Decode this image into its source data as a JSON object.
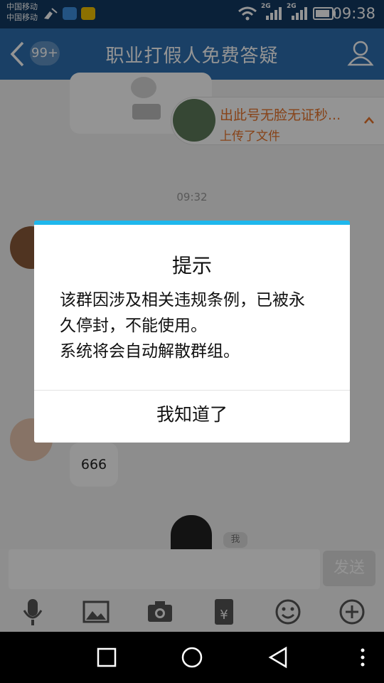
{
  "status_bar": {
    "carrier1": "中国移动",
    "carrier2": "中国移动",
    "network1": "2G",
    "network2": "2G",
    "time": "09:38"
  },
  "header": {
    "back_badge": "99+",
    "title": "职业打假人免费答疑"
  },
  "notification": {
    "title": "出此号无脸无证秒...",
    "subtitle": "上传了文件"
  },
  "chat": {
    "timestamp": "09:32",
    "message_666": "666",
    "self_tag": "我"
  },
  "input_bar": {
    "placeholder": "",
    "send_label": "发送",
    "tools": [
      "mic-icon",
      "image-icon",
      "camera-icon",
      "red-packet-icon",
      "emoji-icon",
      "plus-icon"
    ]
  },
  "dialog": {
    "title": "提示",
    "body_lines": [
      "该群因涉及相关违规条例，已被永",
      "久停封，不能使用。",
      "系统将会自动解散群组。"
    ],
    "button": "我知道了"
  },
  "colors": {
    "titlebar": "#2d6fb0",
    "dialog_accent": "#1fb7ec",
    "notif_text": "#e8742a"
  }
}
